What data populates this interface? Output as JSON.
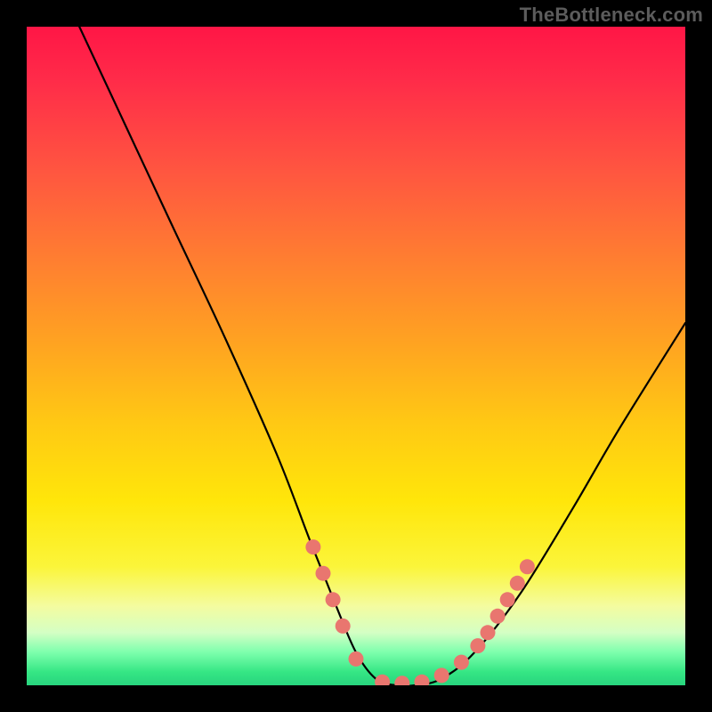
{
  "watermark": "TheBottleneck.com",
  "chart_data": {
    "type": "line",
    "title": "",
    "xlabel": "",
    "ylabel": "",
    "xlim": [
      0,
      100
    ],
    "ylim": [
      0,
      100
    ],
    "series": [
      {
        "name": "curve",
        "x": [
          8,
          15,
          22,
          30,
          38,
          43,
          47,
          50,
          53,
          56,
          59,
          63,
          68,
          75,
          83,
          90,
          100
        ],
        "y": [
          100,
          85,
          70,
          53,
          35,
          22,
          12,
          5,
          1,
          0,
          0,
          1,
          5,
          14,
          27,
          39,
          55
        ]
      }
    ],
    "markers": {
      "name": "highlight-dots",
      "color": "#e9766f",
      "points": [
        {
          "x": 43.5,
          "y": 21
        },
        {
          "x": 45.0,
          "y": 17
        },
        {
          "x": 46.5,
          "y": 13
        },
        {
          "x": 48.0,
          "y": 9
        },
        {
          "x": 50.0,
          "y": 4
        },
        {
          "x": 54.0,
          "y": 0.5
        },
        {
          "x": 57.0,
          "y": 0.3
        },
        {
          "x": 60.0,
          "y": 0.5
        },
        {
          "x": 63.0,
          "y": 1.5
        },
        {
          "x": 66.0,
          "y": 3.5
        },
        {
          "x": 68.5,
          "y": 6
        },
        {
          "x": 70.0,
          "y": 8
        },
        {
          "x": 71.5,
          "y": 10.5
        },
        {
          "x": 73.0,
          "y": 13
        },
        {
          "x": 74.5,
          "y": 15.5
        },
        {
          "x": 76.0,
          "y": 18
        }
      ]
    }
  }
}
